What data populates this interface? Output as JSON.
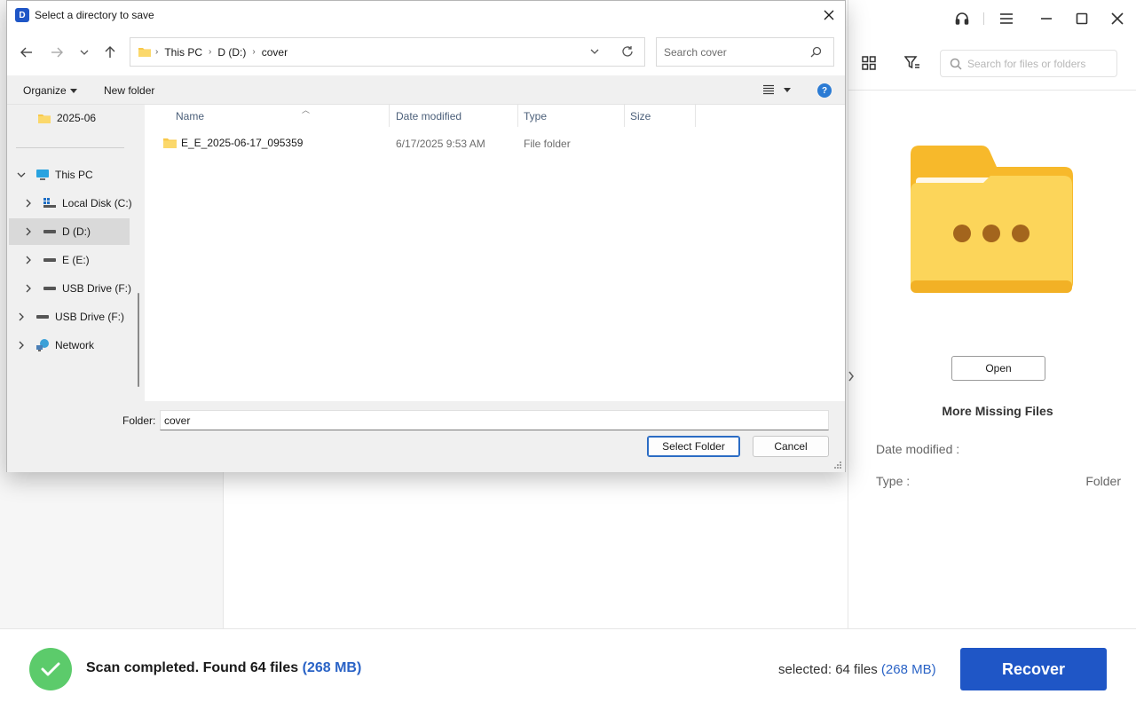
{
  "app": {
    "search_placeholder": "Search for files or folders",
    "open_label": "Open",
    "more_missing": "More Missing Files",
    "date_modified_label": "Date modified :",
    "date_modified_value": "",
    "type_label": "Type :",
    "type_value": "Folder",
    "scan_prefix": "Scan completed. Found 64 files",
    "scan_size": "(268 MB)",
    "selected_prefix": "selected: 64 files",
    "selected_size": "(268 MB)",
    "recover_label": "Recover",
    "colors": {
      "accent": "#1f56c6",
      "success": "#5ccb6b",
      "folder_yellow": "#f9c81e"
    }
  },
  "dialog": {
    "title": "Select a directory to save",
    "app_icon_letter": "D",
    "breadcrumb": [
      "This PC",
      "D (D:)",
      "cover"
    ],
    "search_placeholder": "Search cover",
    "organize": "Organize",
    "new_folder": "New folder",
    "help": "?",
    "tree": [
      {
        "label": "2025-06",
        "icon": "folder-icon"
      },
      {
        "label": "This PC",
        "icon": "computer-icon"
      },
      {
        "label": "Local Disk (C:)",
        "icon": "system-drive-icon"
      },
      {
        "label": "D (D:)",
        "icon": "drive-icon"
      },
      {
        "label": "E (E:)",
        "icon": "drive-icon"
      },
      {
        "label": "USB Drive (F:)",
        "icon": "drive-icon"
      },
      {
        "label": "USB Drive (F:)",
        "icon": "drive-icon"
      },
      {
        "label": "Network",
        "icon": "network-icon"
      }
    ],
    "columns": [
      "Name",
      "Date modified",
      "Type",
      "Size"
    ],
    "files": [
      {
        "name": "E_E_2025-06-17_095359",
        "date": "6/17/2025 9:53 AM",
        "type": "File folder",
        "size": ""
      }
    ],
    "folder_label": "Folder:",
    "folder_value": "cover",
    "select_folder": "Select Folder",
    "cancel": "Cancel"
  }
}
